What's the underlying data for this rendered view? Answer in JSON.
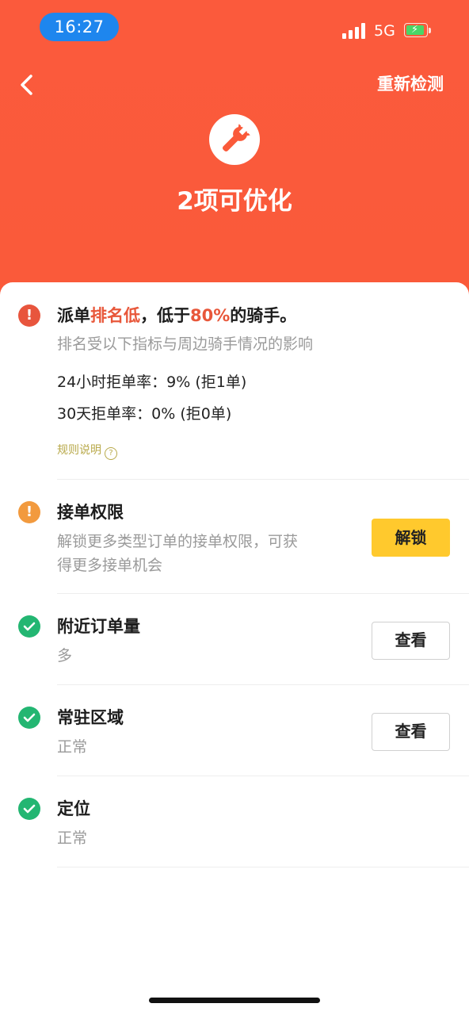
{
  "status_bar": {
    "time": "16:27",
    "network": "5G",
    "battery_bolt": "⚡"
  },
  "header": {
    "back_icon": "chevron-left-icon",
    "recheck_label": "重新检测",
    "tool_icon": "wrench-icon",
    "title": "2项可优化",
    "bg_color": "#fa5a3a"
  },
  "ranking": {
    "title_prefix": "派单",
    "title_highlight1": "排名低",
    "title_mid": "，低于",
    "title_highlight2": "80%",
    "title_suffix": "的骑手。",
    "subtitle": "排名受以下指标与周边骑手情况的影响",
    "metrics": [
      "24小时拒单率：9% (拒1单)",
      "30天拒单率：0% (拒0单)"
    ],
    "rule_link": "规则说明",
    "rule_icon": "question-circle-icon",
    "status_icon": "alert-red-icon"
  },
  "items": [
    {
      "title": "接单权限",
      "subtitle_lines": [
        "解锁更多类型订单的接单权限，可获",
        "得更多接单机会"
      ],
      "button": "解锁",
      "status": "warning",
      "status_icon": "alert-orange-icon"
    },
    {
      "title": "附近订单量",
      "subtitle_lines": [
        "多"
      ],
      "button": "查看",
      "status": "ok",
      "status_icon": "check-green-icon"
    },
    {
      "title": "常驻区域",
      "subtitle_lines": [
        "正常"
      ],
      "button": "查看",
      "status": "ok",
      "status_icon": "check-green-icon"
    },
    {
      "title": "定位",
      "subtitle_lines": [
        "正常"
      ],
      "status": "ok",
      "status_icon": "check-green-icon"
    }
  ],
  "colors": {
    "accent_red": "#e8573a",
    "warning_orange": "#f29a3e",
    "ok_green": "#23b672",
    "button_yellow": "#ffc92d"
  }
}
